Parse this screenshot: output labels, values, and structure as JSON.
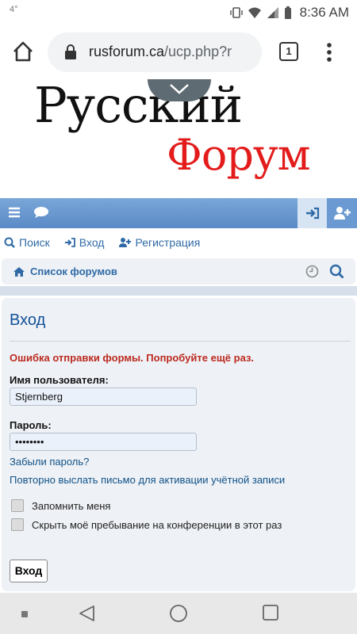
{
  "status": {
    "temperature": "4°",
    "time": "8:36 AM"
  },
  "browser": {
    "url_domain": "rusforum.ca",
    "url_path": "/ucp.php?r",
    "tab_count": "1"
  },
  "logo": {
    "line1": "Русский",
    "line2": "Форум"
  },
  "quicklinks": {
    "search": "Поиск",
    "login": "Вход",
    "register": "Регистрация"
  },
  "breadcrumb": {
    "forum_list": "Список форумов"
  },
  "form": {
    "title": "Вход",
    "error": "Ошибка отправки формы. Попробуйте ещё раз.",
    "username_label": "Имя пользователя:",
    "username_value": "Stjernberg",
    "password_label": "Пароль:",
    "password_value": "••••••••",
    "forgot_password": "Забыли пароль?",
    "resend_activation": "Повторно выслать письмо для активации учётной записи",
    "remember_me": "Запомнить меня",
    "hide_presence": "Скрыть моё пребывание на конференции в этот раз",
    "submit": "Вход"
  },
  "colors": {
    "accent": "#2f6aa6",
    "error": "#bc2a20",
    "navbar": "#6b9ad3",
    "logo_red": "#e31b1b"
  }
}
